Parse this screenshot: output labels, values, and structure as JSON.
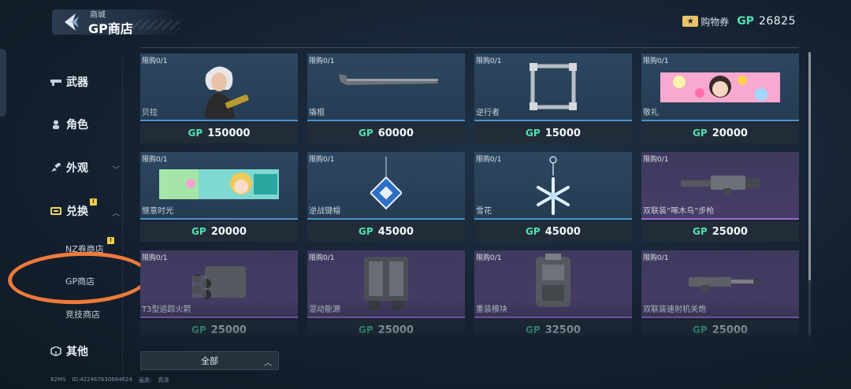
{
  "header": {
    "breadcrumb": "商城",
    "title": "GP商店",
    "voucher_label": "购物券",
    "gp_label": "GP",
    "gp_balance": "26825"
  },
  "sidebar": {
    "items": [
      {
        "label": "武器"
      },
      {
        "label": "角色"
      },
      {
        "label": "外观",
        "chevron": "﹀"
      },
      {
        "label": "兑换",
        "chevron": "︿",
        "badge": "!"
      }
    ],
    "sub_items": [
      {
        "label": "NZ券商店",
        "badge": "!"
      },
      {
        "label": "GP商店",
        "selected": true
      },
      {
        "label": "竞技商店"
      }
    ],
    "other": {
      "label": "其他"
    }
  },
  "status": {
    "ping": "82MS",
    "id": "ID:422467630684624",
    "quality_label": "画质:",
    "quality_value": "高清"
  },
  "shop": {
    "currency": "GP",
    "items": [
      {
        "limit": "限购0/1",
        "name": "贝拉",
        "price": "150000",
        "rarity": "blue",
        "icon": "character-bella"
      },
      {
        "limit": "限购0/1",
        "name": "撬棍",
        "price": "60000",
        "rarity": "blue",
        "icon": "crowbar"
      },
      {
        "limit": "限购0/1",
        "name": "逆行者",
        "price": "15000",
        "rarity": "blue",
        "icon": "frame"
      },
      {
        "limit": "限购0/1",
        "name": "敬礼",
        "price": "20000",
        "rarity": "blue",
        "icon": "banner-salute"
      },
      {
        "limit": "限购0/1",
        "name": "惬意时光",
        "price": "20000",
        "rarity": "blue",
        "icon": "banner-leisure"
      },
      {
        "limit": "限购0/1",
        "name": "逆战键帽",
        "price": "45000",
        "rarity": "blue",
        "icon": "keycap-pendant"
      },
      {
        "limit": "限购0/1",
        "name": "雪花",
        "price": "45000",
        "rarity": "blue",
        "icon": "snowflake-pendant"
      },
      {
        "limit": "限购0/1",
        "name": "双联装“啄木鸟”步枪",
        "price": "25000",
        "rarity": "purple",
        "icon": "rifle"
      },
      {
        "limit": "限购0/1",
        "name": "T3型追踪火箭",
        "price": "25000",
        "rarity": "purple",
        "icon": "rocket-pod"
      },
      {
        "limit": "限购0/1",
        "name": "混动能源",
        "price": "25000",
        "rarity": "purple",
        "icon": "power-pack"
      },
      {
        "limit": "限购0/1",
        "name": "重装模块",
        "price": "32500",
        "rarity": "purple",
        "icon": "armor-module"
      },
      {
        "limit": "限购0/1",
        "name": "双联装速射机关炮",
        "price": "25000",
        "rarity": "purple",
        "icon": "autocannon"
      }
    ]
  },
  "filter": {
    "label": "全部",
    "caret": "︿"
  },
  "colors": {
    "gp_accent": "#4fe0b0",
    "blue_rarity": "#4b94c6",
    "purple_rarity": "#9a6ad0",
    "highlight_ring": "#f07a3a"
  }
}
